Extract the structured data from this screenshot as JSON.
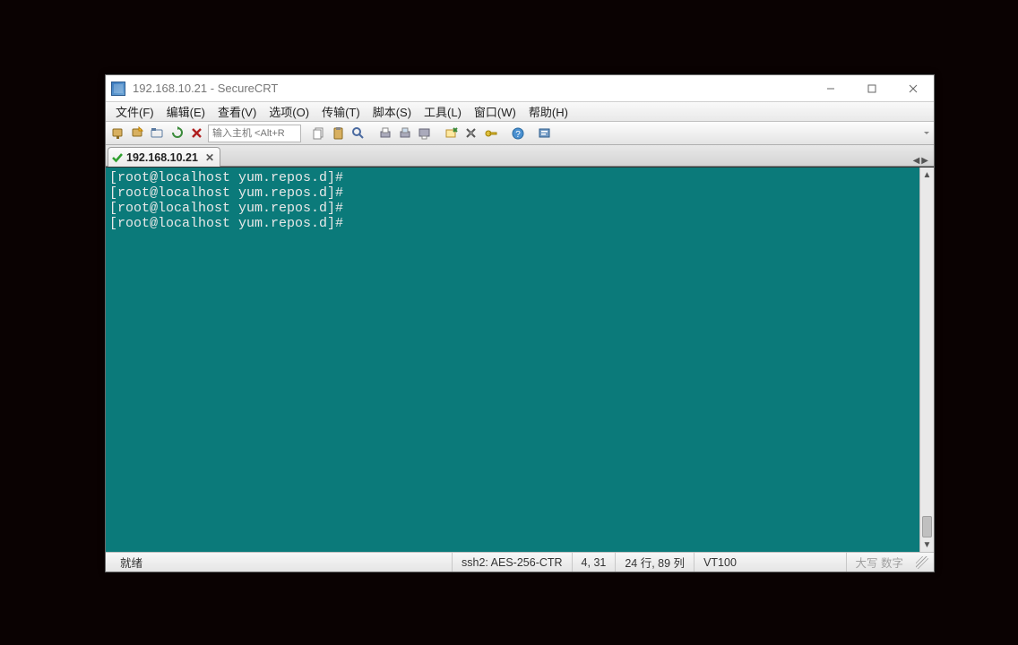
{
  "window": {
    "title": "192.168.10.21 - SecureCRT"
  },
  "menus": {
    "file": "文件(F)",
    "edit": "编辑(E)",
    "view": "查看(V)",
    "options": "选项(O)",
    "transfer": "传输(T)",
    "script": "脚本(S)",
    "tools": "工具(L)",
    "window": "窗口(W)",
    "help": "帮助(H)"
  },
  "toolbar": {
    "host_placeholder": "输入主机 <Alt+R"
  },
  "tabs": [
    {
      "label": "192.168.10.21",
      "connected": true
    }
  ],
  "terminal": {
    "lines": [
      "[root@localhost yum.repos.d]#",
      "[root@localhost yum.repos.d]#",
      "[root@localhost yum.repos.d]#",
      "[root@localhost yum.repos.d]#"
    ]
  },
  "statusbar": {
    "ready": "就绪",
    "crypto": "ssh2: AES-256-CTR",
    "cursor": "4,  31",
    "size": "24 行, 89 列",
    "term": "VT100",
    "caps": "大写 数字"
  }
}
